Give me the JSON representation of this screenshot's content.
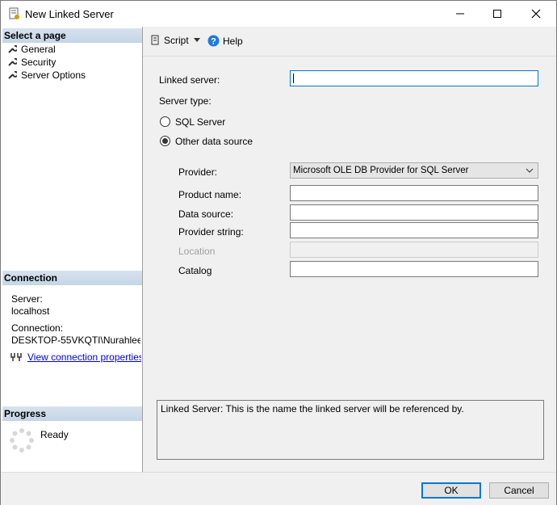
{
  "window": {
    "title": "New Linked Server"
  },
  "left": {
    "select_page_header": "Select a page",
    "pages": [
      "General",
      "Security",
      "Server Options"
    ],
    "connection_header": "Connection",
    "server_label": "Server:",
    "server_value": "localhost",
    "connection_label": "Connection:",
    "connection_value": "DESKTOP-55VKQTI\\Nurahleem",
    "view_connection_link": "View connection properties",
    "progress_header": "Progress",
    "progress_status": "Ready"
  },
  "toolbar": {
    "script_label": "Script",
    "help_label": "Help"
  },
  "form": {
    "linked_server_label": "Linked server:",
    "linked_server_value": "",
    "server_type_label": "Server type:",
    "sql_server_label": "SQL Server",
    "other_source_label": "Other data source",
    "selected_type": "Other data source",
    "provider_label": "Provider:",
    "provider_value": "Microsoft OLE DB Provider for SQL Server",
    "product_name_label": "Product name:",
    "data_source_label": "Data source:",
    "provider_string_label": "Provider string:",
    "location_label": "Location",
    "catalog_label": "Catalog"
  },
  "description": "Linked Server: This is the name the linked server will be referenced by.",
  "footer": {
    "ok_label": "OK",
    "cancel_label": "Cancel"
  },
  "colors": {
    "accent": "#0078d7",
    "link": "#0000ee",
    "section_header": "#c9d9e8"
  },
  "icons": [
    "app-icon",
    "minimize-icon",
    "maximize-icon",
    "close-icon",
    "wrench-icon",
    "script-icon",
    "dropdown-arrow-icon",
    "help-icon",
    "connection-icon",
    "spinner-icon",
    "chevron-down-icon"
  ]
}
